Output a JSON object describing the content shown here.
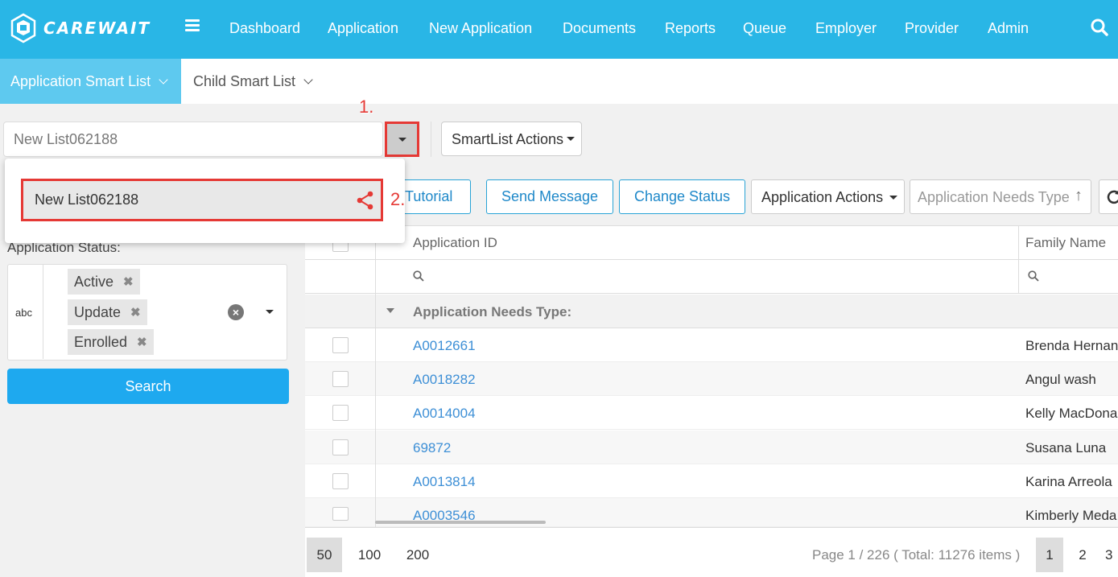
{
  "app": {
    "brand": "CAREWAIT"
  },
  "nav": {
    "items": [
      "Dashboard",
      "Application",
      "New Application",
      "Documents",
      "Reports",
      "Queue",
      "Employer",
      "Provider",
      "Admin"
    ]
  },
  "subtabs": {
    "active": "Application Smart List",
    "other": "Child Smart List"
  },
  "smartlist": {
    "selected": "New List062188",
    "actions_label": "SmartList Actions",
    "dropdown_option": "New List062188"
  },
  "annotations": {
    "step1": "1.",
    "step2": "2."
  },
  "filter": {
    "label": "Application Status:",
    "type_icon": "abc",
    "tags": [
      "Active",
      "Update",
      "Enrolled"
    ],
    "search_label": "Search"
  },
  "toolbar": {
    "tutorial": "Tutorial",
    "send_message": "Send Message",
    "change_status": "Change Status",
    "application_actions": "Application Actions",
    "needs_type_placeholder": "Application Needs Type"
  },
  "grid": {
    "columns": [
      "Application ID",
      "Family Name"
    ],
    "group_label": "Application Needs Type:",
    "rows": [
      {
        "id": "A0012661",
        "family": "Brenda Hernan"
      },
      {
        "id": "A0018282",
        "family": "Angul wash"
      },
      {
        "id": "A0014004",
        "family": "Kelly MacDona"
      },
      {
        "id": "69872",
        "family": "Susana Luna"
      },
      {
        "id": "A0013814",
        "family": "Karina Arreola"
      },
      {
        "id": "A0003546",
        "family": "Kimberly Meda"
      }
    ]
  },
  "pager": {
    "sizes": [
      "50",
      "100",
      "200"
    ],
    "summary": "Page 1 / 226 ( Total: 11276 items )",
    "pages": [
      "1",
      "2",
      "3"
    ]
  },
  "colors": {
    "primary": "#29b6e6",
    "accent": "#1ea9ef",
    "highlight": "#e53935"
  }
}
